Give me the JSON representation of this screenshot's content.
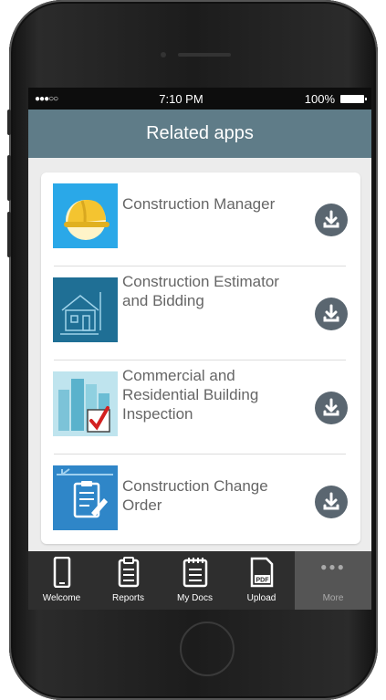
{
  "status_bar": {
    "carrier_dots": "●●●○○",
    "time": "7:10 PM",
    "battery": "100%"
  },
  "header": {
    "title": "Related apps"
  },
  "apps": [
    {
      "name": "Construction Manager",
      "icon": "hard-hat-icon"
    },
    {
      "name": "Construction Estimator and Bidding",
      "icon": "house-blueprint-icon"
    },
    {
      "name": "Commercial and Residential Building Inspection",
      "icon": "buildings-checkbox-icon"
    },
    {
      "name": "Construction Change Order",
      "icon": "clipboard-crane-icon"
    }
  ],
  "tabs": [
    {
      "label": "Welcome",
      "icon": "phone-icon"
    },
    {
      "label": "Reports",
      "icon": "clipboard-icon"
    },
    {
      "label": "My Docs",
      "icon": "notepad-icon"
    },
    {
      "label": "Upload",
      "icon": "pdf-icon"
    },
    {
      "label": "More",
      "icon": "ellipsis-icon"
    }
  ],
  "colors": {
    "header": "#5f7c88",
    "tabbar": "#2e2e2e",
    "download_button": "#5a6670"
  }
}
